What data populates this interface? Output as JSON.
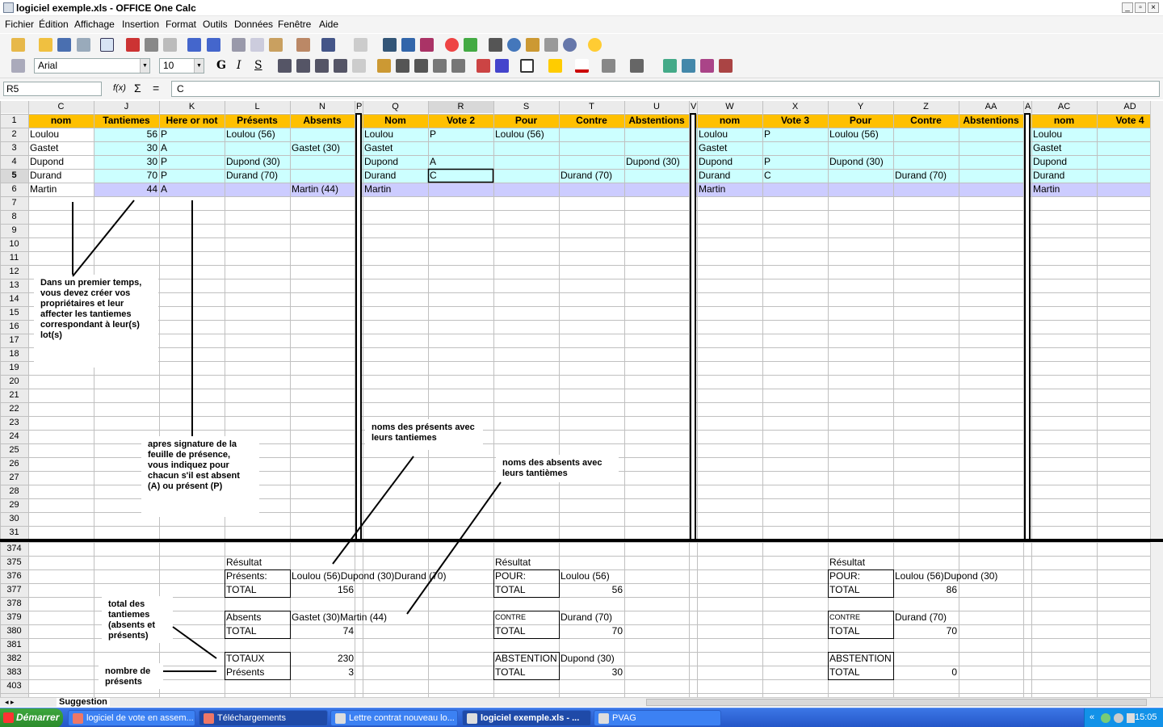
{
  "window": {
    "title": "logiciel exemple.xls - OFFICE One Calc"
  },
  "menu": [
    "Fichier",
    "Édition",
    "Affichage",
    "Insertion",
    "Format",
    "Outils",
    "Données",
    "Fenêtre",
    "Aide"
  ],
  "format_bar": {
    "font": "Arial",
    "size": "10"
  },
  "formula_bar": {
    "cell_ref": "R5",
    "fx": "f(x)",
    "sigma": "Σ",
    "equals": "=",
    "content": "C"
  },
  "columns1": [
    "C",
    "J",
    "K",
    "L",
    "N",
    "P",
    "Q",
    "R",
    "S",
    "T",
    "U",
    "V",
    "W",
    "X",
    "Y",
    "Z",
    "AA",
    "AB",
    "AC",
    "AD"
  ],
  "rows1": [
    "1",
    "2",
    "3",
    "4",
    "5",
    "6",
    "7",
    "8",
    "9",
    "10",
    "11",
    "12",
    "13",
    "14",
    "15",
    "16",
    "17",
    "18",
    "19",
    "20",
    "21",
    "22",
    "23",
    "24",
    "25",
    "26",
    "27",
    "28",
    "29",
    "30",
    "31"
  ],
  "rows2": [
    "374",
    "375",
    "376",
    "377",
    "378",
    "379",
    "380",
    "381",
    "382",
    "383",
    "403"
  ],
  "headers": {
    "c": "nom",
    "j": "Tantiemes",
    "k": "Here or not",
    "l": "Présents",
    "n": "Absents",
    "q": "Nom",
    "r": "Vote 2",
    "s": "Pour",
    "t": "Contre",
    "u": "Abstentions",
    "w": "nom",
    "x": "Vote 3",
    "y": "Pour",
    "z": "Contre",
    "aa": "Abstentions",
    "ac": "nom",
    "ad": "Vote 4"
  },
  "rows": [
    {
      "nom": "Loulou",
      "tant": "56",
      "here": "P",
      "pres": "Loulou (56)",
      "abs": "",
      "q": "Loulou",
      "r": "P",
      "s": "Loulou (56)",
      "t": "",
      "u": "",
      "w": "Loulou",
      "x": "P",
      "y": "Loulou (56)",
      "z": "",
      "ac": "Loulou"
    },
    {
      "nom": "Gastet",
      "tant": "30",
      "here": "A",
      "pres": "",
      "abs": "Gastet (30)",
      "q": "Gastet",
      "r": "",
      "s": "",
      "t": "",
      "u": "",
      "w": "Gastet",
      "x": "",
      "y": "",
      "z": "",
      "ac": "Gastet"
    },
    {
      "nom": "Dupond",
      "tant": "30",
      "here": "P",
      "pres": "Dupond (30)",
      "abs": "",
      "q": "Dupond",
      "r": "A",
      "s": "",
      "t": "",
      "u": "Dupond (30)",
      "w": "Dupond",
      "x": "P",
      "y": "Dupond (30)",
      "z": "",
      "ac": "Dupond"
    },
    {
      "nom": "Durand",
      "tant": "70",
      "here": "P",
      "pres": "Durand (70)",
      "abs": "",
      "q": "Durand",
      "r": "C",
      "s": "",
      "t": "Durand (70)",
      "u": "",
      "w": "Durand",
      "x": "C",
      "y": "",
      "z": "Durand (70)",
      "ac": "Durand"
    },
    {
      "nom": "Martin",
      "tant": "44",
      "here": "A",
      "pres": "",
      "abs": "Martin (44)",
      "q": "Martin",
      "r": "",
      "s": "",
      "t": "",
      "u": "",
      "w": "Martin",
      "x": "",
      "y": "",
      "z": "",
      "ac": "Martin"
    }
  ],
  "results": {
    "resultat": "Résultat",
    "presents_label": "Présents:",
    "presents_vals": "Loulou (56)Dupond (30)Durand (70)",
    "total": "TOTAL",
    "total_pres": "156",
    "absents_label": "Absents",
    "absents_vals": "Gastet (30)Martin (44)",
    "total_abs": "74",
    "totaux": "TOTAUX",
    "totaux_val": "230",
    "presents2": "Présents",
    "presents_count": "3",
    "pour": "POUR:",
    "pour2_vals": "Loulou (56)",
    "pour2_total": "56",
    "contre": "CONTRE",
    "contre2_vals": "Durand (70)",
    "contre2_total": "70",
    "abst": "ABSTENTION",
    "abst2_vals": "Dupond (30)",
    "abst2_total": "30",
    "pour3_vals": "Loulou (56)Dupond (30)",
    "pour3_total": "86",
    "contre3_vals": "Durand (70)",
    "contre3_total": "70",
    "abst3_total": "0"
  },
  "annotations": {
    "a1": "Dans un premier temps, vous devez créer vos propriétaires et leur affecter les tantiemes correspondant à leur(s) lot(s)",
    "a2": "apres signature de la feuille de présence, vous indiquez pour chacun s'il est absent (A) ou présent (P)",
    "a3": "noms des présents avec leurs tantiemes",
    "a4": "noms des absents avec leurs tantièmes",
    "a5": "total des tantiemes (absents et présents)",
    "a6": "nombre de présents"
  },
  "sheet_tab": "Suggestion",
  "taskbar": {
    "start": "Démarrer",
    "tasks": [
      "logiciel de vote en assem...",
      "Téléchargements",
      "Lettre contrat nouveau lo...",
      "logiciel exemple.xls - ...",
      "PVAG"
    ],
    "clock": "15:05"
  },
  "colors": {
    "header": "#ffc000",
    "row_cyan": "#ccffff",
    "row_lav": "#ccccff",
    "taskbar": "#245edb"
  }
}
